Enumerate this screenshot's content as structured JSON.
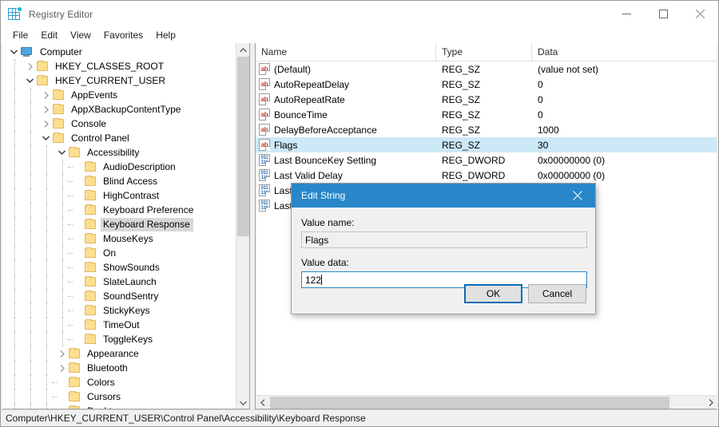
{
  "window": {
    "title": "Registry Editor",
    "icon": "registry-editor-icon",
    "controls": {
      "minimize": "minimize-icon",
      "maximize": "maximize-icon",
      "close": "close-icon"
    }
  },
  "menu": {
    "items": [
      "File",
      "Edit",
      "View",
      "Favorites",
      "Help"
    ]
  },
  "tree": {
    "nodes": [
      {
        "label": "Computer",
        "depth": 0,
        "state": "expanded",
        "icon": "computer-icon",
        "selected": false
      },
      {
        "label": "HKEY_CLASSES_ROOT",
        "depth": 1,
        "state": "collapsed",
        "icon": "folder-icon",
        "selected": false
      },
      {
        "label": "HKEY_CURRENT_USER",
        "depth": 1,
        "state": "expanded",
        "icon": "folder-icon",
        "selected": false
      },
      {
        "label": "AppEvents",
        "depth": 2,
        "state": "collapsed",
        "icon": "folder-icon",
        "selected": false
      },
      {
        "label": "AppXBackupContentType",
        "depth": 2,
        "state": "collapsed",
        "icon": "folder-icon",
        "selected": false
      },
      {
        "label": "Console",
        "depth": 2,
        "state": "collapsed",
        "icon": "folder-icon",
        "selected": false
      },
      {
        "label": "Control Panel",
        "depth": 2,
        "state": "expanded",
        "icon": "folder-icon",
        "selected": false
      },
      {
        "label": "Accessibility",
        "depth": 3,
        "state": "expanded",
        "icon": "folder-icon",
        "selected": false
      },
      {
        "label": "AudioDescription",
        "depth": 4,
        "state": "leaf",
        "icon": "folder-icon",
        "selected": false
      },
      {
        "label": "Blind Access",
        "depth": 4,
        "state": "leaf",
        "icon": "folder-icon",
        "selected": false
      },
      {
        "label": "HighContrast",
        "depth": 4,
        "state": "leaf",
        "icon": "folder-icon",
        "selected": false
      },
      {
        "label": "Keyboard Preference",
        "depth": 4,
        "state": "leaf",
        "icon": "folder-icon",
        "selected": false
      },
      {
        "label": "Keyboard Response",
        "depth": 4,
        "state": "leaf",
        "icon": "folder-icon",
        "selected": true
      },
      {
        "label": "MouseKeys",
        "depth": 4,
        "state": "leaf",
        "icon": "folder-icon",
        "selected": false
      },
      {
        "label": "On",
        "depth": 4,
        "state": "leaf",
        "icon": "folder-icon",
        "selected": false
      },
      {
        "label": "ShowSounds",
        "depth": 4,
        "state": "leaf",
        "icon": "folder-icon",
        "selected": false
      },
      {
        "label": "SlateLaunch",
        "depth": 4,
        "state": "leaf",
        "icon": "folder-icon",
        "selected": false
      },
      {
        "label": "SoundSentry",
        "depth": 4,
        "state": "leaf",
        "icon": "folder-icon",
        "selected": false
      },
      {
        "label": "StickyKeys",
        "depth": 4,
        "state": "leaf",
        "icon": "folder-icon",
        "selected": false
      },
      {
        "label": "TimeOut",
        "depth": 4,
        "state": "leaf",
        "icon": "folder-icon",
        "selected": false
      },
      {
        "label": "ToggleKeys",
        "depth": 4,
        "state": "leaf",
        "icon": "folder-icon",
        "selected": false
      },
      {
        "label": "Appearance",
        "depth": 3,
        "state": "collapsed",
        "icon": "folder-icon",
        "selected": false
      },
      {
        "label": "Bluetooth",
        "depth": 3,
        "state": "collapsed",
        "icon": "folder-icon",
        "selected": false
      },
      {
        "label": "Colors",
        "depth": 3,
        "state": "leaf",
        "icon": "folder-icon",
        "selected": false
      },
      {
        "label": "Cursors",
        "depth": 3,
        "state": "leaf",
        "icon": "folder-icon",
        "selected": false
      },
      {
        "label": "Desktop",
        "depth": 3,
        "state": "leaf",
        "icon": "folder-icon",
        "selected": false
      }
    ]
  },
  "list": {
    "columns": [
      "Name",
      "Type",
      "Data"
    ],
    "rows": [
      {
        "name": "(Default)",
        "type": "REG_SZ",
        "data": "(value not set)",
        "icon": "string-value-icon",
        "selected": false
      },
      {
        "name": "AutoRepeatDelay",
        "type": "REG_SZ",
        "data": "0",
        "icon": "string-value-icon",
        "selected": false
      },
      {
        "name": "AutoRepeatRate",
        "type": "REG_SZ",
        "data": "0",
        "icon": "string-value-icon",
        "selected": false
      },
      {
        "name": "BounceTime",
        "type": "REG_SZ",
        "data": "0",
        "icon": "string-value-icon",
        "selected": false
      },
      {
        "name": "DelayBeforeAcceptance",
        "type": "REG_SZ",
        "data": "1000",
        "icon": "string-value-icon",
        "selected": false
      },
      {
        "name": "Flags",
        "type": "REG_SZ",
        "data": "30",
        "icon": "string-value-icon",
        "selected": true
      },
      {
        "name": "Last BounceKey Setting",
        "type": "REG_DWORD",
        "data": "0x00000000 (0)",
        "icon": "dword-value-icon",
        "selected": false
      },
      {
        "name": "Last Valid Delay",
        "type": "REG_DWORD",
        "data": "0x00000000 (0)",
        "icon": "dword-value-icon",
        "selected": false
      },
      {
        "name": "Last",
        "type": "",
        "data": "",
        "icon": "dword-value-icon",
        "selected": false
      },
      {
        "name": "Last",
        "type": "",
        "data": "000)",
        "icon": "dword-value-icon",
        "selected": false
      }
    ]
  },
  "dialog": {
    "title": "Edit String",
    "close_icon": "close-icon",
    "value_name_label": "Value name:",
    "value_name": "Flags",
    "value_data_label": "Value data:",
    "value_data": "122",
    "ok_label": "OK",
    "cancel_label": "Cancel"
  },
  "statusbar": {
    "path": "Computer\\HKEY_CURRENT_USER\\Control Panel\\Accessibility\\Keyboard Response"
  },
  "colors": {
    "accent": "#2787c8",
    "selection": "#cde8f7",
    "tree_selection": "#d8d8d8",
    "folder": "#fcdf8e",
    "string_icon": "#c0392b",
    "dword_icon": "#2a6fb5"
  }
}
